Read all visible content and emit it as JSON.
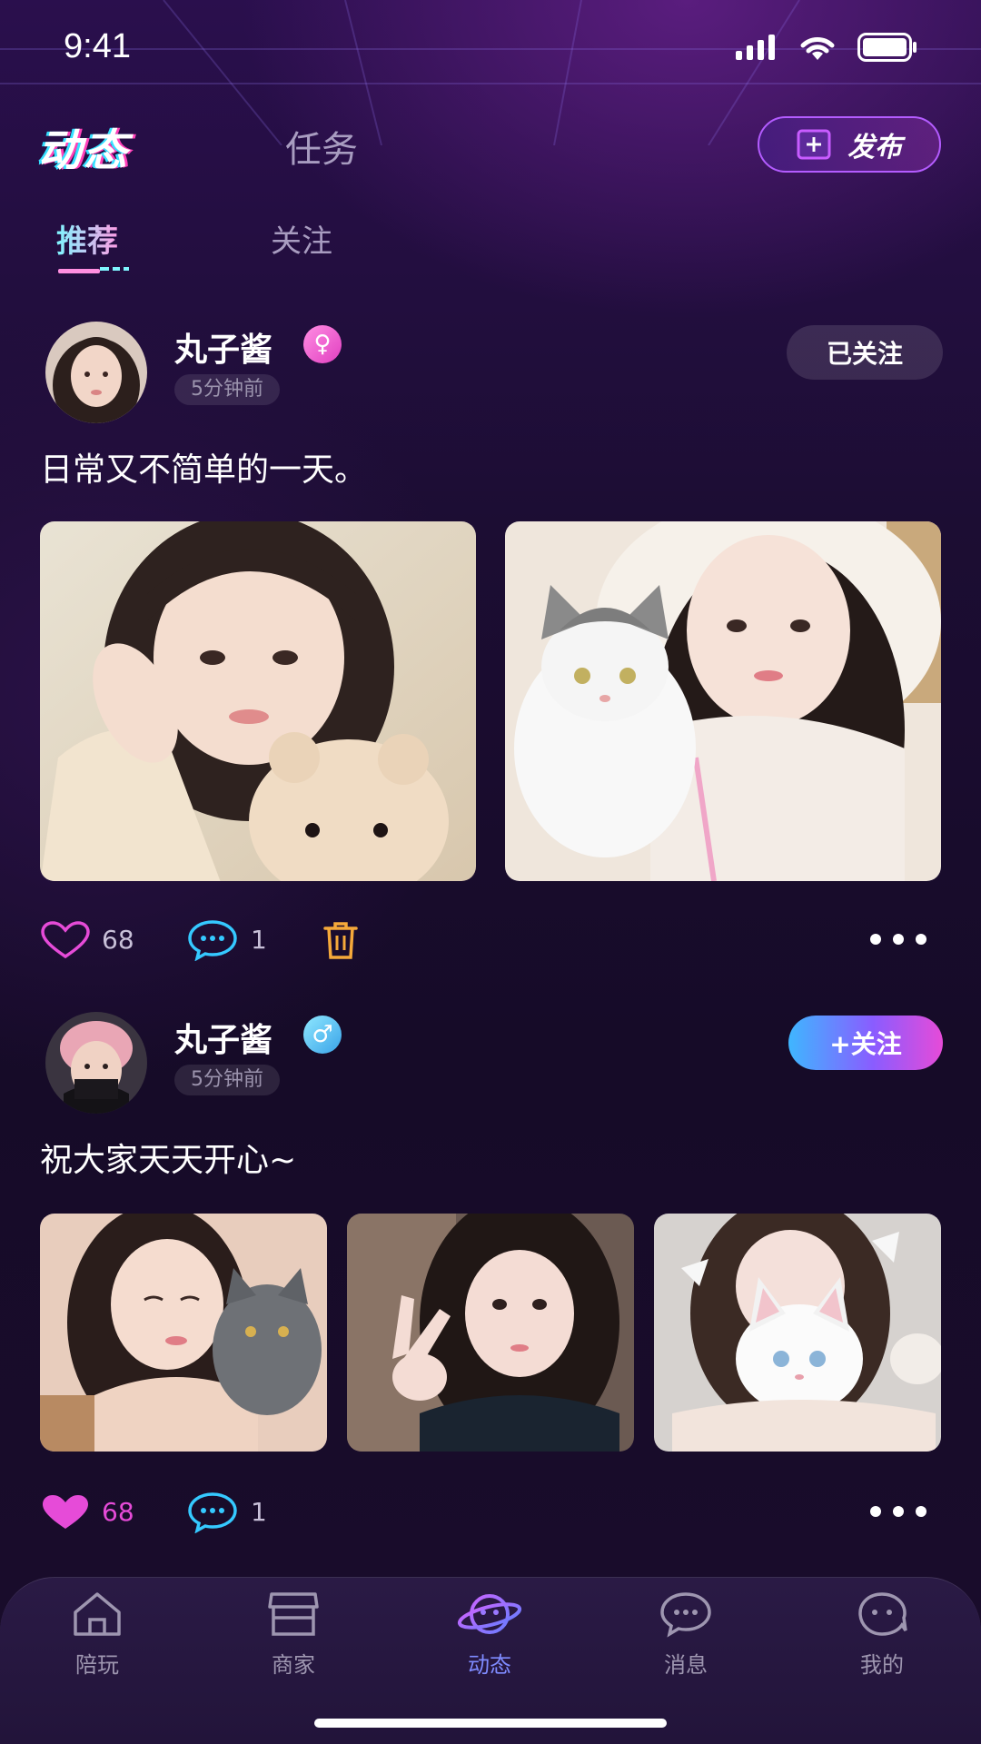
{
  "status_bar": {
    "time": "9:41"
  },
  "top_nav": {
    "active_tab": "动态",
    "inactive_tab": "任务",
    "publish_label": "发布"
  },
  "sub_tabs": {
    "active": "推荐",
    "inactive": "关注"
  },
  "posts": [
    {
      "username": "丸子酱",
      "gender": "female",
      "time": "5分钟前",
      "follow_label": "已关注",
      "followed": true,
      "text": "日常又不简单的一天。",
      "photo_count": 2,
      "likes": "68",
      "comments": "1",
      "liked": false,
      "has_delete": true
    },
    {
      "username": "丸子酱",
      "gender": "male",
      "time": "5分钟前",
      "follow_label": "+关注",
      "followed": false,
      "text": "祝大家天天开心~",
      "photo_count": 3,
      "likes": "68",
      "comments": "1",
      "liked": true,
      "has_delete": false
    }
  ],
  "tab_bar": {
    "items": [
      {
        "label": "陪玩",
        "icon": "home-icon"
      },
      {
        "label": "商家",
        "icon": "store-icon"
      },
      {
        "label": "动态",
        "icon": "planet-icon",
        "active": true
      },
      {
        "label": "消息",
        "icon": "message-icon"
      },
      {
        "label": "我的",
        "icon": "profile-icon"
      }
    ]
  },
  "colors": {
    "accent_purple": "#7f8bff",
    "pink": "#e64bd8",
    "cyan": "#35c9ff",
    "orange": "#f5a93a"
  }
}
